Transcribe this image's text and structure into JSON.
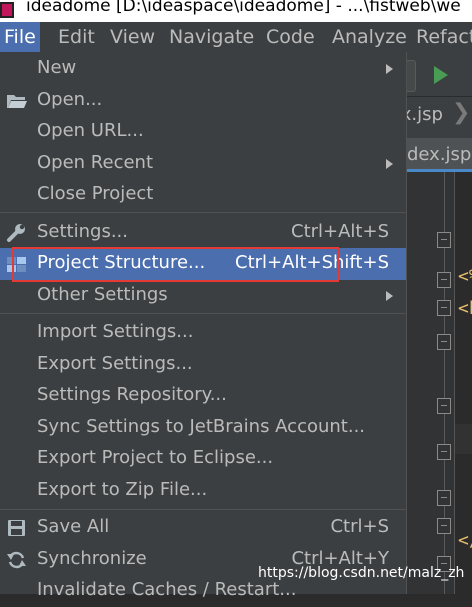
{
  "titlebar": {
    "title": "ideadome [D:\\ideaspace\\ideadome] - ...\\fistweb\\we"
  },
  "menubar": {
    "items": [
      "File",
      "Edit",
      "View",
      "Navigate",
      "Code",
      "Analyze",
      "Refacto"
    ]
  },
  "editor": {
    "nav_file": "ex.jsp",
    "tab_label": "dex.jsp",
    "code_fragments": [
      "<%",
      "<h",
      "</"
    ]
  },
  "file_menu": {
    "items": [
      {
        "label": "New",
        "shortcut": "",
        "submenu": true
      },
      {
        "label": "Open...",
        "shortcut": "",
        "icon": "folder-open-icon"
      },
      {
        "label": "Open URL...",
        "shortcut": ""
      },
      {
        "label": "Open Recent",
        "shortcut": "",
        "submenu": true
      },
      {
        "label": "Close Project",
        "shortcut": ""
      },
      {
        "label": "Settings...",
        "shortcut": "Ctrl+Alt+S",
        "icon": "wrench-icon"
      },
      {
        "label": "Project Structure...",
        "shortcut": "Ctrl+Alt+Shift+S",
        "icon": "project-structure-icon",
        "selected": true
      },
      {
        "label": "Other Settings",
        "shortcut": "",
        "submenu": true
      },
      {
        "label": "Import Settings...",
        "shortcut": ""
      },
      {
        "label": "Export Settings...",
        "shortcut": ""
      },
      {
        "label": "Settings Repository...",
        "shortcut": ""
      },
      {
        "label": "Sync Settings to JetBrains Account...",
        "shortcut": ""
      },
      {
        "label": "Export Project to Eclipse...",
        "shortcut": ""
      },
      {
        "label": "Export to Zip File...",
        "shortcut": ""
      },
      {
        "label": "Save All",
        "shortcut": "Ctrl+S",
        "icon": "save-icon"
      },
      {
        "label": "Synchronize",
        "shortcut": "Ctrl+Alt+Y",
        "icon": "sync-icon"
      },
      {
        "label": "Invalidate Caches / Restart...",
        "shortcut": ""
      }
    ]
  },
  "watermark": "https://blog.csdn.net/malz_zh",
  "colors": {
    "menu_bg": "#3c3f41",
    "selection": "#4b6eaf",
    "annotation": "#e53935"
  }
}
